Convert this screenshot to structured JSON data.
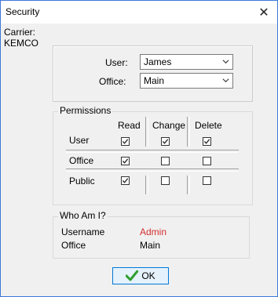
{
  "window": {
    "title": "Security",
    "close_symbol": "✕"
  },
  "carrier": {
    "label": "Carrier:",
    "value": "KEMCO"
  },
  "user_form": {
    "user_label": "User:",
    "user_value": "James",
    "office_label": "Office:",
    "office_value": "Main"
  },
  "permissions": {
    "title": "Permissions",
    "columns": [
      "Read",
      "Change",
      "Delete"
    ],
    "rows": [
      {
        "label": "User",
        "checked": [
          true,
          true,
          true
        ]
      },
      {
        "label": "Office",
        "checked": [
          true,
          false,
          false
        ]
      },
      {
        "label": "Public",
        "checked": [
          true,
          false,
          false
        ]
      }
    ]
  },
  "whoami": {
    "title": "Who Am I?",
    "username_label": "Username",
    "username_value": "Admin",
    "username_color": "#d32f2f",
    "office_label": "Office",
    "office_value": "Main"
  },
  "ok_button": {
    "label": "OK",
    "icon": "checkmark-icon",
    "icon_color": "#2e9e2e"
  }
}
